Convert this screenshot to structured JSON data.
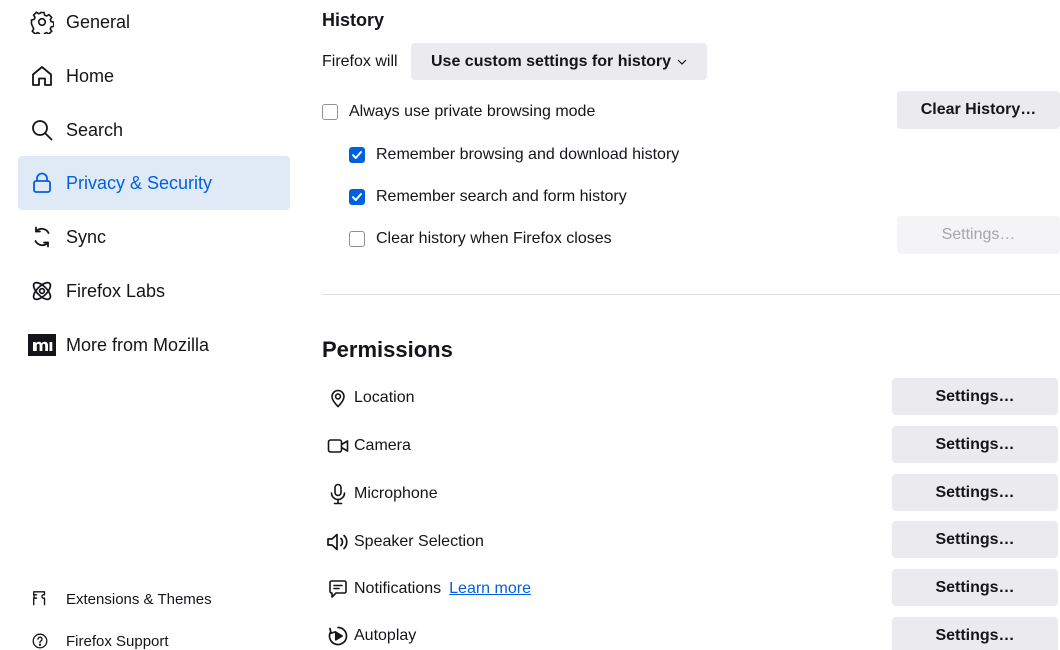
{
  "sidebar": {
    "items": [
      {
        "label": "General",
        "icon": "gear-icon"
      },
      {
        "label": "Home",
        "icon": "home-icon"
      },
      {
        "label": "Search",
        "icon": "search-icon"
      },
      {
        "label": "Privacy & Security",
        "icon": "lock-icon",
        "selected": true
      },
      {
        "label": "Sync",
        "icon": "sync-icon"
      },
      {
        "label": "Firefox Labs",
        "icon": "labs-icon"
      },
      {
        "label": "More from Mozilla",
        "icon": "mozilla-logo-icon"
      }
    ],
    "footer": [
      {
        "label": "Extensions & Themes",
        "icon": "puzzle-icon"
      },
      {
        "label": "Firefox Support",
        "icon": "help-icon"
      }
    ]
  },
  "history": {
    "title": "History",
    "firefox_will_label": "Firefox will",
    "mode_value": "Use custom settings for history",
    "clear_history_button": "Clear History…",
    "options": [
      {
        "label": "Always use private browsing mode",
        "checked": false
      },
      {
        "label": "Remember browsing and download history",
        "checked": true
      },
      {
        "label": "Remember search and form history",
        "checked": true
      },
      {
        "label": "Clear history when Firefox closes",
        "checked": false
      }
    ],
    "settings_button": "Settings…"
  },
  "permissions": {
    "title": "Permissions",
    "learn_more": "Learn more",
    "items": [
      {
        "label": "Location",
        "icon": "location-pin-icon",
        "button": "Settings…"
      },
      {
        "label": "Camera",
        "icon": "camera-icon",
        "button": "Settings…"
      },
      {
        "label": "Microphone",
        "icon": "microphone-icon",
        "button": "Settings…"
      },
      {
        "label": "Speaker Selection",
        "icon": "speaker-icon",
        "button": "Settings…"
      },
      {
        "label": "Notifications",
        "icon": "notification-icon",
        "button": "Settings…"
      },
      {
        "label": "Autoplay",
        "icon": "autoplay-icon",
        "button": "Settings…"
      }
    ]
  },
  "colors": {
    "accent": "#0061e0",
    "selected_bg": "#e0eaf6",
    "button_bg": "#ebebef"
  }
}
